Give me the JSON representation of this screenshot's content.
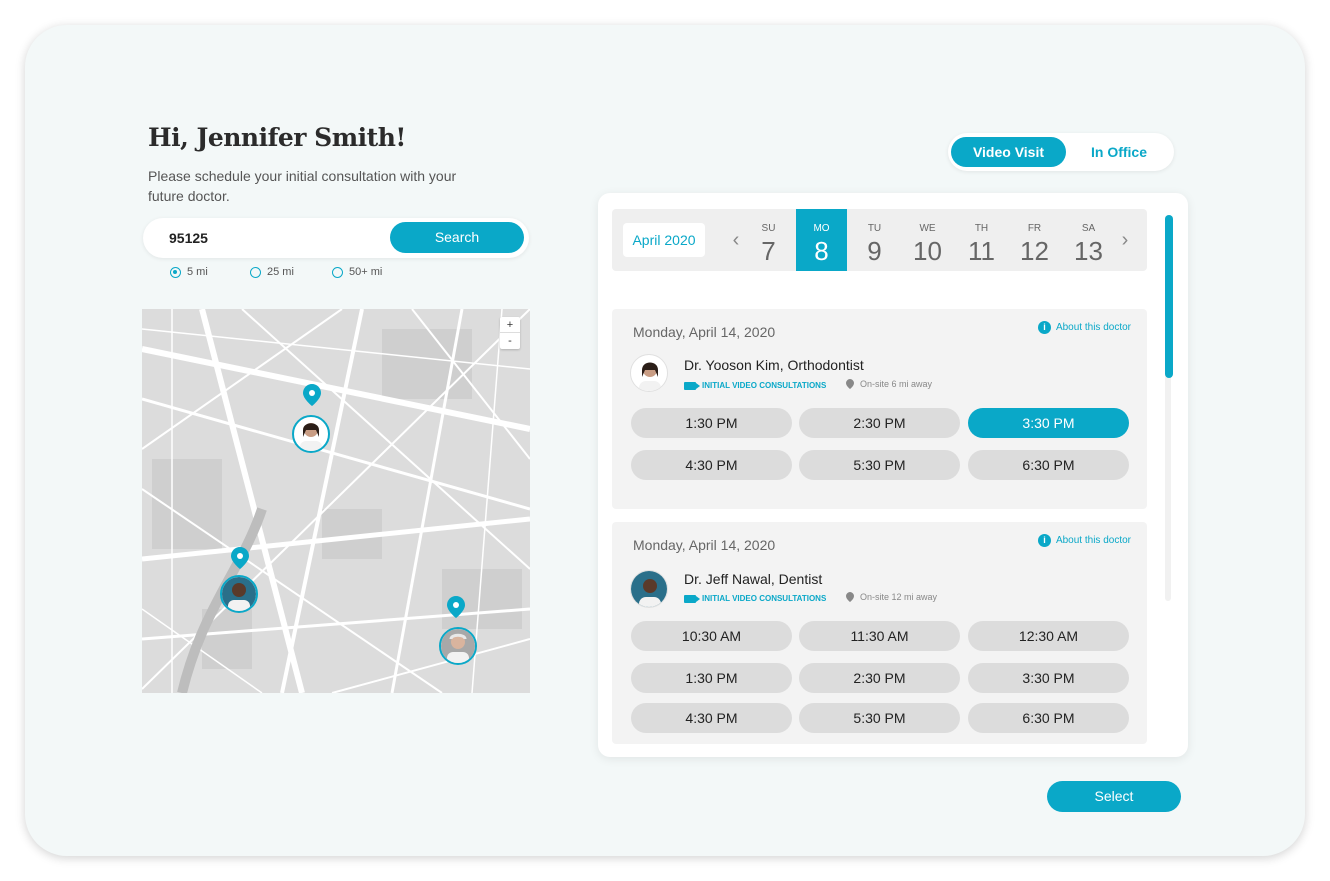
{
  "greeting": "Hi, Jennifer Smith!",
  "subtitle": "Please schedule your initial consultation with your future doctor.",
  "search": {
    "value": "95125",
    "button_label": "Search"
  },
  "radius_options": [
    {
      "label": "5 mi",
      "selected": true
    },
    {
      "label": "25 mi",
      "selected": false
    },
    {
      "label": "50+ mi",
      "selected": false
    }
  ],
  "map": {
    "zoom_in": "+",
    "zoom_out": "-"
  },
  "visit_toggle": {
    "options": [
      "Video Visit",
      "In Office"
    ],
    "selected": "Video Visit"
  },
  "calendar": {
    "month": "April 2020",
    "days": [
      {
        "dow": "SU",
        "num": "7",
        "active": false
      },
      {
        "dow": "MO",
        "num": "8",
        "active": true
      },
      {
        "dow": "TU",
        "num": "9",
        "active": false
      },
      {
        "dow": "WE",
        "num": "10",
        "active": false
      },
      {
        "dow": "TH",
        "num": "11",
        "active": false
      },
      {
        "dow": "FR",
        "num": "12",
        "active": false
      },
      {
        "dow": "SA",
        "num": "13",
        "active": false
      }
    ]
  },
  "doctors": [
    {
      "date": "Monday, April 14, 2020",
      "about": "About this doctor",
      "name": "Dr. Yooson Kim, Orthodontist",
      "consult_type": "INITIAL VIDEO CONSULTATIONS",
      "distance": "On-site 6 mi away",
      "slots": [
        "1:30 PM",
        "2:30 PM",
        "3:30 PM",
        "4:30 PM",
        "5:30 PM",
        "6:30 PM"
      ],
      "selected_slot": "3:30 PM"
    },
    {
      "date": "Monday, April 14, 2020",
      "about": "About this doctor",
      "name": "Dr. Jeff Nawal, Dentist",
      "consult_type": "INITIAL VIDEO CONSULTATIONS",
      "distance": "On-site 12 mi away",
      "slots": [
        "10:30 AM",
        "11:30 AM",
        "12:30 AM",
        "1:30 PM",
        "2:30 PM",
        "3:30 PM",
        "4:30 PM",
        "5:30 PM",
        "6:30 PM"
      ],
      "selected_slot": ""
    }
  ],
  "select_button": "Select",
  "colors": {
    "accent": "#0aa8c8",
    "background": "#f3f8f8"
  }
}
